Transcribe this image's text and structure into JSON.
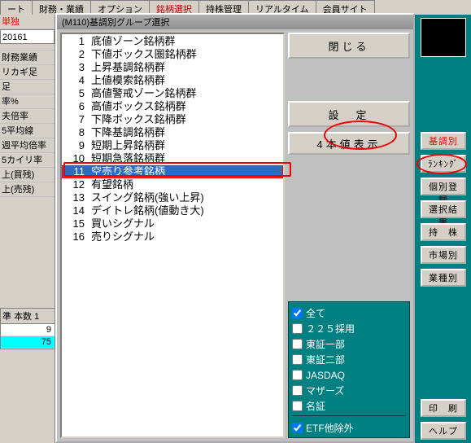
{
  "top_tabs": {
    "t0": "ート",
    "t1": "財務・業績",
    "t2": "オプション",
    "t3": "銘柄選択",
    "t4": "持株管理",
    "t5": "リアルタイム",
    "t6": "会員サイト"
  },
  "left": {
    "tab_lone": "単独",
    "date": "20161",
    "a": "財務業績",
    "b": "リカギ足",
    "c": "足",
    "d": "率%",
    "e": "夫倍率",
    "f": "5平均線",
    "g": "週平均倍率",
    "h": "5カイリ率",
    "i": "上(買残)",
    "j": "上(売残)"
  },
  "table_left": {
    "h1": "準",
    "h2": "本数",
    "h3": "1",
    "r1": "9",
    "r2": "75"
  },
  "dialog": {
    "title": "(M110)基調別グループ選択",
    "close_label": "閉じる",
    "set_label": "設　定",
    "ohlc_label": "4本値表示"
  },
  "list": {
    "i1": {
      "n": "1",
      "t": "底値ゾーン銘柄群"
    },
    "i2": {
      "n": "2",
      "t": "下値ボックス圏銘柄群"
    },
    "i3": {
      "n": "3",
      "t": "上昇基調銘柄群"
    },
    "i4": {
      "n": "4",
      "t": "上値模索銘柄群"
    },
    "i5": {
      "n": "5",
      "t": "高値警戒ゾーン銘柄群"
    },
    "i6": {
      "n": "6",
      "t": "高値ボックス銘柄群"
    },
    "i7": {
      "n": "7",
      "t": "下降ボックス銘柄群"
    },
    "i8": {
      "n": "8",
      "t": "下降基調銘柄群"
    },
    "i9": {
      "n": "9",
      "t": "短期上昇銘柄群"
    },
    "i10": {
      "n": "10",
      "t": "短期急落銘柄群"
    },
    "i11": {
      "n": "11",
      "t": "空売り参考銘柄"
    },
    "i12": {
      "n": "12",
      "t": "有望銘柄"
    },
    "i13": {
      "n": "13",
      "t": "スイング銘柄(強い上昇)"
    },
    "i14": {
      "n": "14",
      "t": "デイトレ銘柄(値動き大)"
    },
    "i15": {
      "n": "15",
      "t": "買いシグナル"
    },
    "i16": {
      "n": "16",
      "t": "売りシグナル"
    }
  },
  "checks": {
    "all": "全て",
    "n225": "２２５採用",
    "tse1": "東証一部",
    "tse2": "東証二部",
    "jasdaq": "JASDAQ",
    "mothers": "マザーズ",
    "meisho": "名証",
    "etf": "ETF他除外"
  },
  "right_buttons": {
    "kicho": "基調別",
    "rank": "ﾗﾝｷﾝｸﾞ",
    "indiv": "個別登録",
    "result": "選択結果",
    "hold": "持　株",
    "market": "市場別",
    "sector": "業種別",
    "print": "印　刷",
    "help": "ヘルプ"
  }
}
